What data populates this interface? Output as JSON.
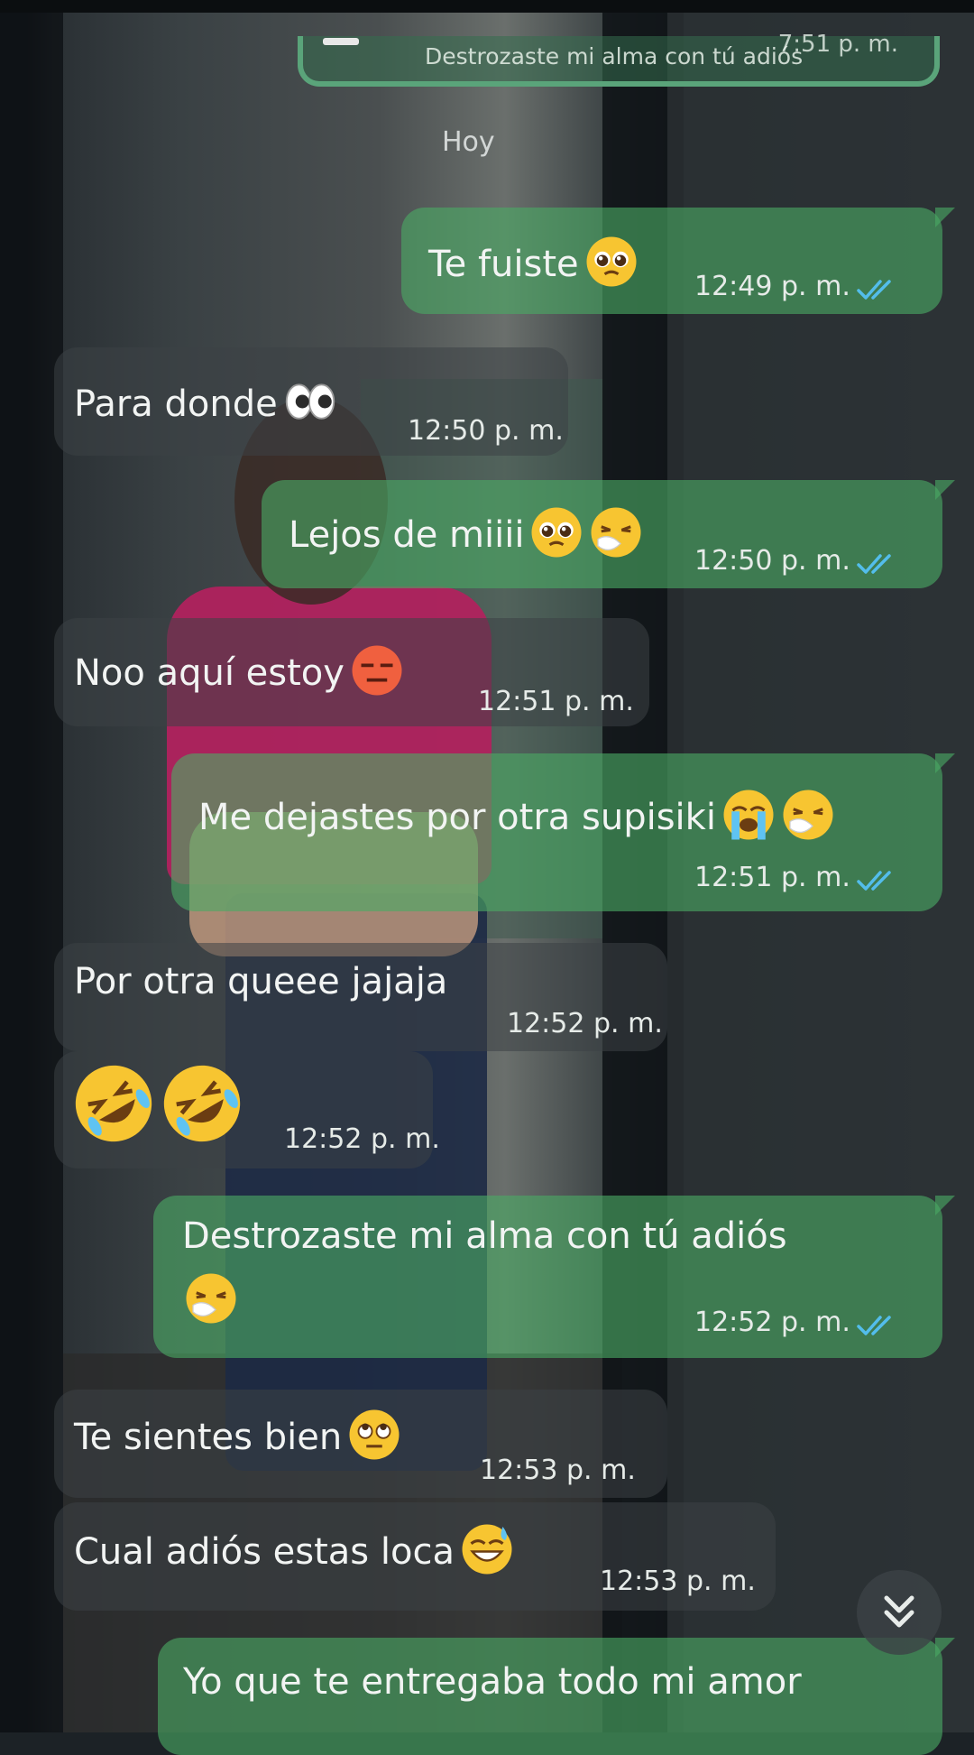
{
  "quote": {
    "text": "Destrozaste mi alma  con tú adiós",
    "time": "7:51 p. m."
  },
  "date_label": "Hoy",
  "messages": [
    {
      "dir": "out",
      "text": "Te fuiste",
      "emojis": [
        "pleading-face"
      ],
      "time": "12:49 p. m."
    },
    {
      "dir": "in",
      "text": "Para donde",
      "emojis": [
        "eyes"
      ],
      "time": "12:50 p. m."
    },
    {
      "dir": "out",
      "text": "Lejos de miiii",
      "emojis": [
        "pleading-face",
        "sneezing-face"
      ],
      "time": "12:50 p. m."
    },
    {
      "dir": "in",
      "text": "Noo aquí estoy",
      "emojis": [
        "expressionless-face"
      ],
      "time": "12:51 p. m."
    },
    {
      "dir": "out",
      "text": "Me dejastes por otra supisiki",
      "emojis": [
        "crying-face",
        "sneezing-face"
      ],
      "time": "12:51 p. m."
    },
    {
      "dir": "in",
      "text": "Por otra queee jajaja",
      "emojis": [],
      "time": "12:52 p. m."
    },
    {
      "dir": "in",
      "text": "",
      "emojis": [
        "rolling-laughing-face",
        "rolling-laughing-face"
      ],
      "time": "12:52 p. m."
    },
    {
      "dir": "out",
      "text": "Destrozaste mi alma con tú adiós",
      "emojis": [
        "sneezing-face"
      ],
      "time": "12:52 p. m."
    },
    {
      "dir": "in",
      "text": "Te sientes bien",
      "emojis": [
        "rolling-eyes-face"
      ],
      "time": "12:53 p. m."
    },
    {
      "dir": "in",
      "text": "Cual adiós estas loca",
      "emojis": [
        "sweat-smile-face"
      ],
      "time": "12:53 p. m."
    },
    {
      "dir": "out",
      "text": "Yo que te entregaba todo mi amor",
      "emojis": [],
      "time": ""
    }
  ],
  "colors": {
    "outgoing": "#4aaa64",
    "incoming": "#3c4246",
    "ticks": "#53bdeb"
  },
  "scroll_icon": "double-chevron-down-icon"
}
